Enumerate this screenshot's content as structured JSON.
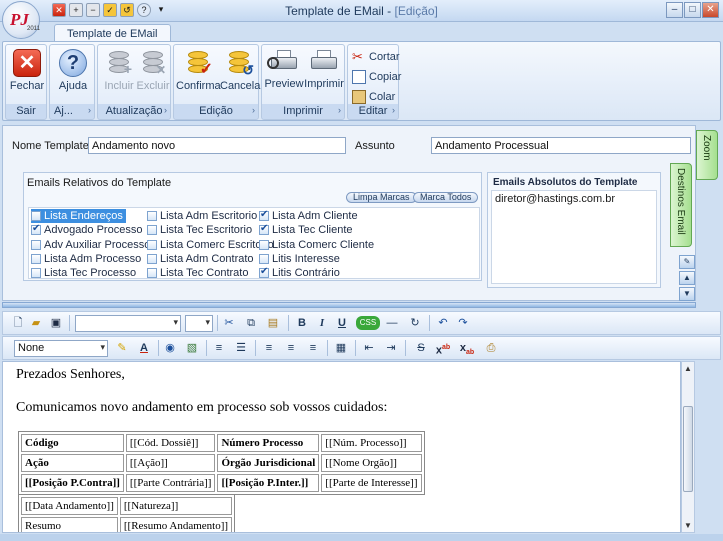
{
  "window": {
    "title": "Template de EMail",
    "mode": "[Edição]",
    "logo_text": "PJ",
    "logo_sub": "2011"
  },
  "ribbon": {
    "tab": "Template de EMail",
    "groups": {
      "sair": {
        "label": "Sair",
        "fechar": "Fechar"
      },
      "ajuda": {
        "label": "Aj...",
        "ajuda": "Ajuda"
      },
      "atualizacao": {
        "label": "Atualização",
        "incluir": "Incluir",
        "excluir": "Excluir"
      },
      "edicao": {
        "label": "Edição",
        "confirma": "Confirma",
        "cancela": "Cancela"
      },
      "imprimir": {
        "label": "Imprimir",
        "preview": "Preview",
        "imprimir": "Imprimir"
      },
      "editar": {
        "label": "Editar",
        "cortar": "Cortar",
        "copiar": "Copiar",
        "colar": "Colar"
      }
    }
  },
  "form": {
    "nome_label": "Nome Template",
    "nome_value": "Andamento novo",
    "assunto_label": "Assunto",
    "assunto_value": "Andamento Processual",
    "relativos_title": "Emails Relativos do Template",
    "limpa_marcas": "Limpa Marcas",
    "marca_todos": "Marca Todos",
    "checkboxes": [
      {
        "label": "Lista Endereços",
        "checked": false,
        "selected": true
      },
      {
        "label": "Advogado Processo",
        "checked": true
      },
      {
        "label": "Adv Auxiliar Processo",
        "checked": false
      },
      {
        "label": "Lista Adm Processo",
        "checked": false
      },
      {
        "label": "Lista Tec Processo",
        "checked": false
      },
      {
        "label": "Lista Adm Escritorio",
        "checked": false
      },
      {
        "label": "Lista Tec Escritorio",
        "checked": false
      },
      {
        "label": "Lista Comerc Escritorio",
        "checked": false
      },
      {
        "label": "Lista Adm Contrato",
        "checked": false
      },
      {
        "label": "Lista Tec Contrato",
        "checked": false
      },
      {
        "label": "Lista Adm Cliente",
        "checked": true
      },
      {
        "label": "Lista Tec Cliente",
        "checked": true
      },
      {
        "label": "Lista Comerc Cliente",
        "checked": false
      },
      {
        "label": "Litis Interesse",
        "checked": false
      },
      {
        "label": "Litis Contrário",
        "checked": true
      }
    ],
    "absolutos_title": "Emails Absolutos do Template",
    "absolutos_items": [
      "diretor@hastings.com.br"
    ]
  },
  "sidetabs": {
    "zoom": "Zoom",
    "destinos": "Destinos Email"
  },
  "editor": {
    "style_combo": "None",
    "font_combo": "",
    "size_combo": ""
  },
  "document": {
    "greeting": "Prezados Senhores,",
    "intro": "Comunicamos novo andamento em processo sob vossos cuidados:",
    "table1": [
      [
        "Código",
        "[[Cód. Dossiê]]",
        "Número Processo",
        "[[Núm. Processo]]"
      ],
      [
        "Ação",
        "[[Ação]]",
        "Órgão Jurisdicional",
        "[[Nome Orgão]]"
      ],
      [
        "[[Posição P.Contra]]",
        "[[Parte Contrária]]",
        "[[Posição P.Inter.]]",
        "[[Parte de Interesse]]"
      ]
    ],
    "table2": [
      [
        "[[Data Andamento]]",
        "[[Natureza]]"
      ],
      [
        "Resumo",
        "[[Resumo Andamento]]"
      ]
    ]
  }
}
